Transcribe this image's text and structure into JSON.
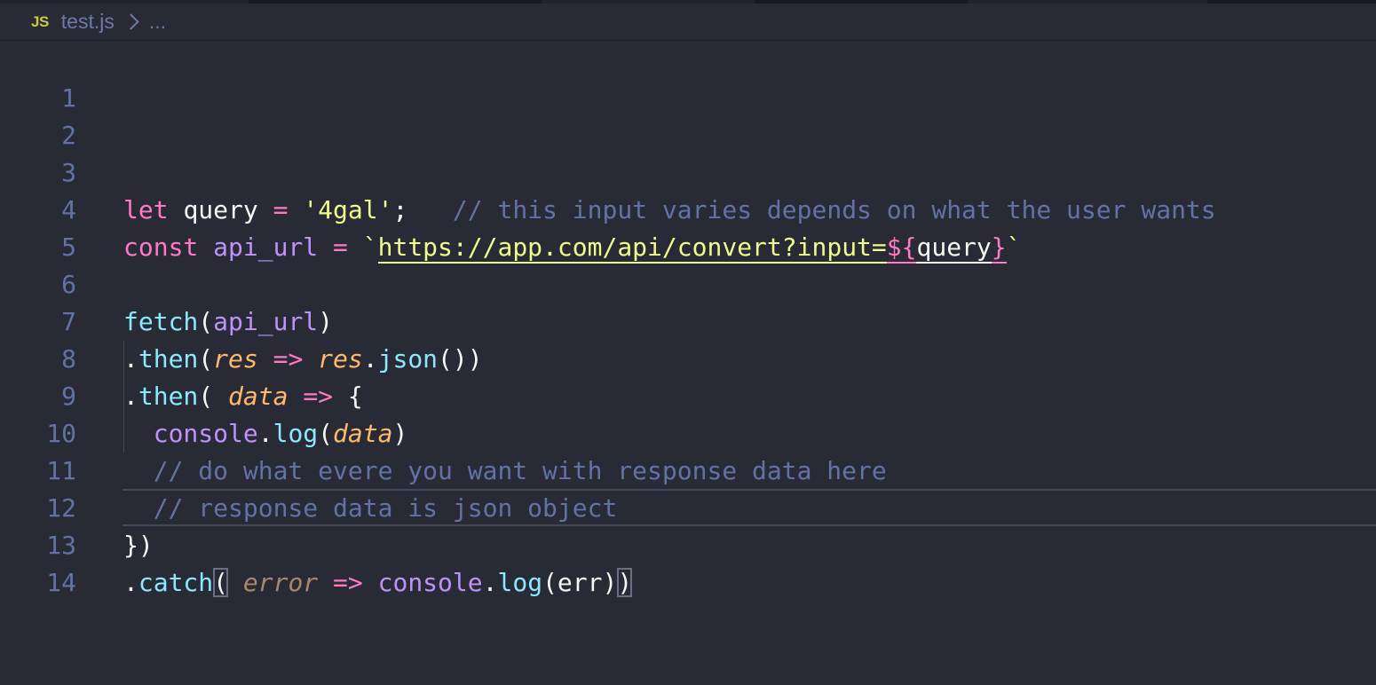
{
  "breadcrumb": {
    "file_icon": "JS",
    "file_name": "test.js",
    "more": "..."
  },
  "lines": {
    "n1": "1",
    "n2": "2",
    "n3": "3",
    "n4": "4",
    "n5": "5",
    "n6": "6",
    "n7": "7",
    "n8": "8",
    "n9": "9",
    "n10": "10",
    "n11": "11",
    "n12": "12",
    "n13": "13",
    "n14": "14"
  },
  "code": {
    "l3": {
      "kw": "let",
      "name": "query",
      "op": "=",
      "str": "'4gal'",
      "semi": ";",
      "comment": "// this input varies depends on what the user wants"
    },
    "l4": {
      "kw": "const",
      "name": "api_url",
      "op": "=",
      "tick_open": "`",
      "url": "https://app.com/api/convert?input=",
      "tpl_open": "${",
      "tpl_var": "query",
      "tpl_close": "}",
      "tick_close": "`"
    },
    "l6": {
      "fn": "fetch",
      "open": "(",
      "arg": "api_url",
      "close": ")"
    },
    "l7": {
      "dot": ".",
      "method": "then",
      "open": "(",
      "param": "res",
      "arrow": "=>",
      "obj": "res",
      "dot2": ".",
      "call": "json",
      "close": "())"
    },
    "l8": {
      "dot": ".",
      "method": "then",
      "open": "(",
      "param": "data",
      "arrow": "=>",
      "brace": "{"
    },
    "l9": {
      "obj": "console",
      "dot": ".",
      "call": "log",
      "open": "(",
      "arg": "data",
      "close": ")"
    },
    "l10": {
      "comment": "// do what evere you want with response data here"
    },
    "l11": {
      "comment": "// response data is json object"
    },
    "l12": {
      "text": "})"
    },
    "l13": {
      "dot": ".",
      "method": "catch",
      "open": "(",
      "param": "error",
      "arrow": "=>",
      "obj": "console",
      "dot2": ".",
      "call": "log",
      "args": "(err)",
      "close": ")"
    }
  },
  "colors": {
    "background": "#282a36",
    "keyword": "#ff79c6",
    "function": "#50fa7b",
    "string": "#f1fa8c",
    "comment": "#6272a4",
    "parameter": "#ffb86c",
    "identifier": "#bd93f9",
    "method": "#8be9fd"
  }
}
